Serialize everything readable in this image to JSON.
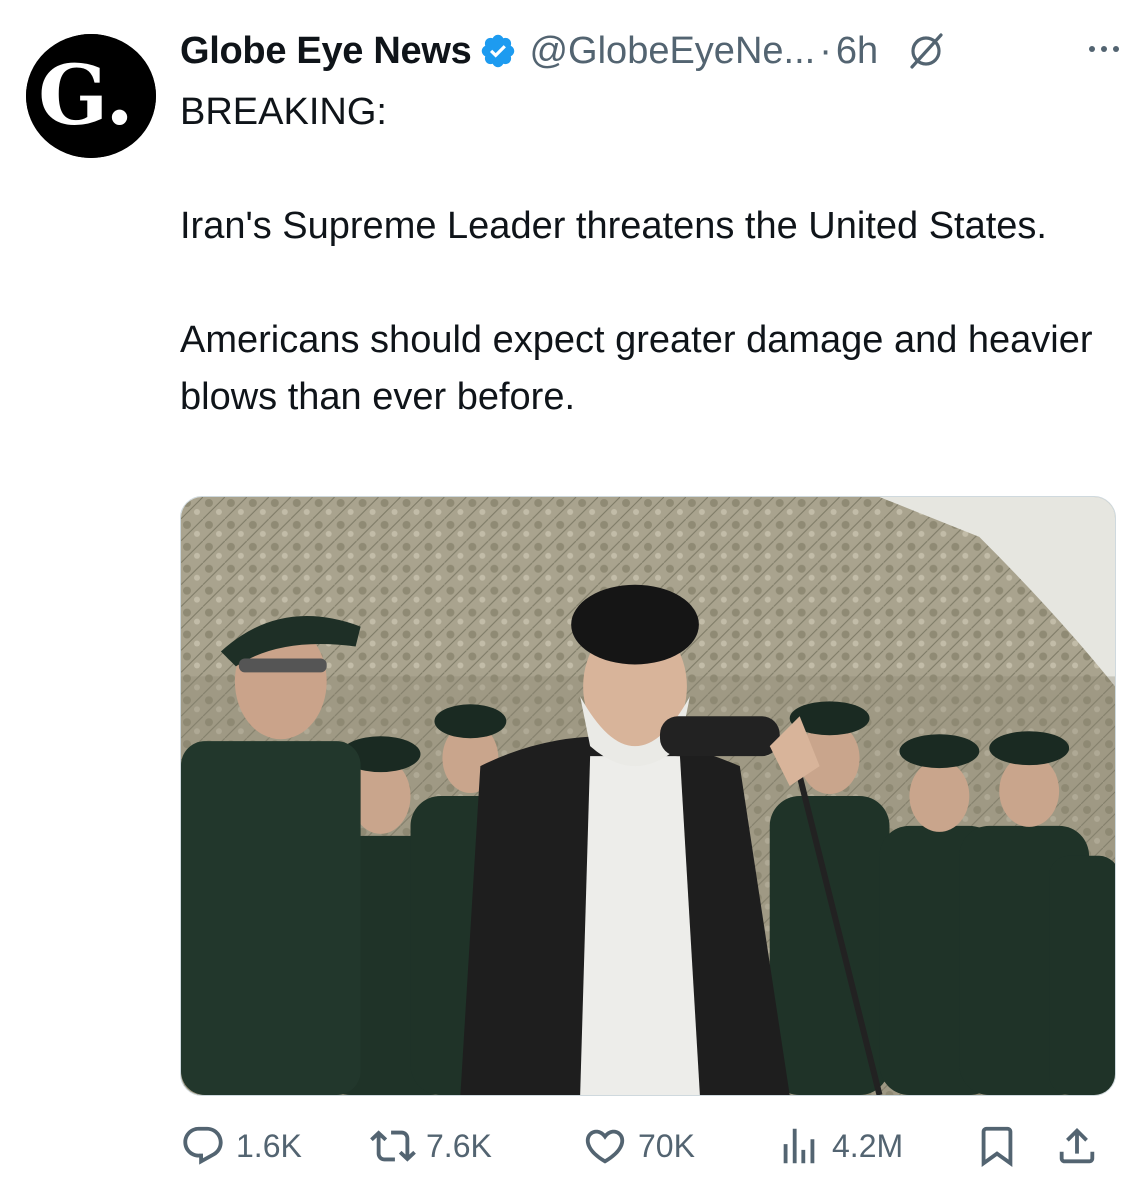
{
  "post": {
    "author_name": "Globe Eye News",
    "handle": "@GlobeEyeNe...",
    "separator": "·",
    "time": "6h",
    "avatar_letter": "G.",
    "text": {
      "line_breaking": "BREAKING:",
      "para1": "Iran's Supreme Leader threatens the United States.",
      "para2": "Americans should expect greater damage and heavier blows than ever before."
    }
  },
  "actions": {
    "replies": "1.6K",
    "reposts": "7.6K",
    "likes": "70K",
    "views": "4.2M"
  },
  "colors": {
    "text": "#0f1419",
    "secondary": "#536471",
    "verified": "#1d9bf0",
    "uniform": "#1f3328"
  },
  "icons": [
    "verified-badge-icon",
    "grok-icon",
    "more-icon",
    "reply-icon",
    "repost-icon",
    "like-icon",
    "views-icon",
    "bookmark-icon",
    "share-icon"
  ]
}
